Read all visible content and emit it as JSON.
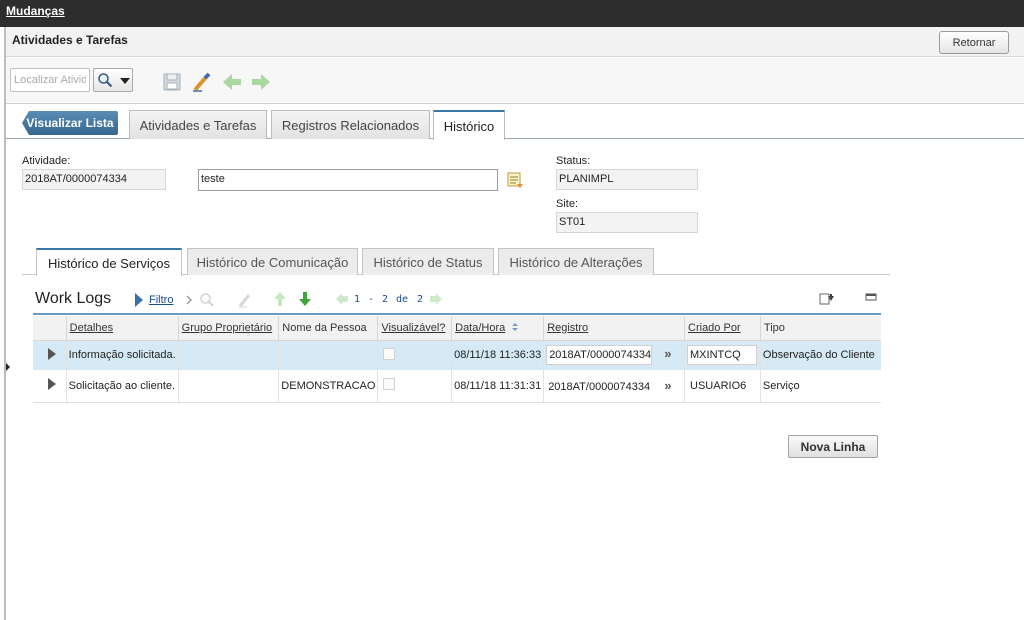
{
  "topbar": {
    "app_link": "Mudanças"
  },
  "titlebar": {
    "title": "Atividades e Tarefas",
    "return_label": "Retornar"
  },
  "toolbar": {
    "locate_placeholder": "Localizar Ativid"
  },
  "main_tabs": {
    "back_label": "Visualizar Lista",
    "tabs": [
      {
        "label": "Atividades e Tarefas",
        "active": false
      },
      {
        "label": "Registros Relacionados",
        "active": false
      },
      {
        "label": "Histórico",
        "active": true
      }
    ]
  },
  "form": {
    "activity_label": "Atividade:",
    "activity_value": "2018AT/0000074334",
    "description_value": "teste",
    "status_label": "Status:",
    "status_value": "PLANIMPL",
    "site_label": "Site:",
    "site_value": "ST01"
  },
  "sub_tabs": [
    {
      "label": "Histórico de Serviços",
      "active": true
    },
    {
      "label": "Histórico de Comunicação",
      "active": false
    },
    {
      "label": "Histórico de Status",
      "active": false
    },
    {
      "label": "Histórico de Alterações",
      "active": false
    }
  ],
  "worklogs": {
    "title": "Work Logs",
    "filter_label": "Filtro",
    "pager": {
      "from": "1",
      "dash": "-",
      "to": "2",
      "of": "de",
      "total": "2"
    },
    "columns": [
      "Detalhes",
      "Grupo Proprietário",
      "Nome da Pessoa",
      "Visualizável?",
      "Data/Hora",
      "Registro",
      "Criado Por",
      "Tipo"
    ],
    "rows": [
      {
        "details": "Informação solicitada.",
        "owner_group": "",
        "person": "",
        "datetime": "08/11/18 11:36:33",
        "record": "2018AT/0000074334",
        "created_by": "MXINTCQ",
        "type": "Observação do Cliente"
      },
      {
        "details": "Solicitação ao cliente.",
        "owner_group": "",
        "person": "DEMONSTRACAO",
        "datetime": "08/11/18 11:31:31",
        "record": "2018AT/0000074334",
        "created_by": "USUARIO6",
        "type": "Serviço"
      }
    ],
    "new_row_label": "Nova Linha"
  },
  "colors": {
    "topbar": "#2d2d2d",
    "accent": "#3b78a8",
    "selected_row": "#d5eaf4",
    "link": "#1a4d8f",
    "nav_green": "#58b04a"
  }
}
